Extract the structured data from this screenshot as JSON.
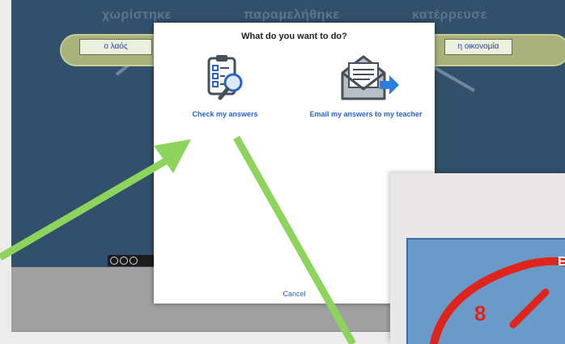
{
  "worksheet": {
    "headers": [
      "χωρίστηκε",
      "παραμελήθηκε",
      "κατέρρευσε"
    ],
    "left_box": "ο λαός",
    "right_box": "η οικονομία"
  },
  "modal": {
    "title": "What do you want to do?",
    "check_label": "Check my answers",
    "email_label": "Email my answers to my teacher",
    "cancel_label": "Cancel",
    "check_icon": "clipboard-checklist-magnifier-icon",
    "email_icon": "envelope-arrow-icon"
  },
  "inset": {
    "visible_text": "E",
    "badge_char": "8"
  },
  "colors": {
    "worksheet_bg": "#32506b",
    "pill": "#a8b27a",
    "link": "#2a63c8",
    "arrow": "#8dd45c"
  }
}
